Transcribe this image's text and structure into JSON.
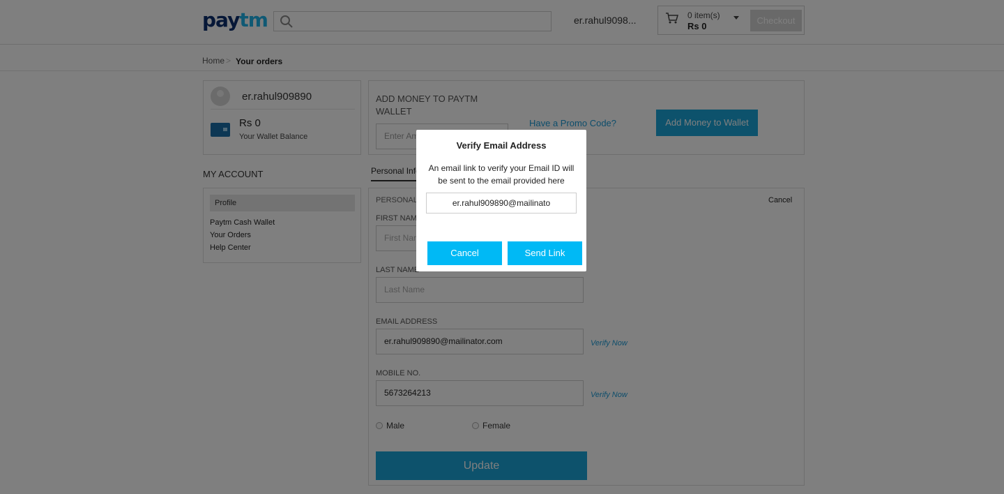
{
  "header": {
    "logo_pay": "pay",
    "logo_tm": "tm",
    "search_placeholder": "",
    "username": "er.rahul9098...",
    "cart_items": "0 item(s)",
    "cart_total": "Rs 0",
    "checkout_label": "Checkout"
  },
  "breadcrumb": {
    "home": "Home",
    "separator": ">",
    "current": "Your orders"
  },
  "profile": {
    "name": "er.rahul909890",
    "wallet_amount": "Rs 0",
    "wallet_label": "Your Wallet Balance"
  },
  "add_money": {
    "title": "ADD MONEY TO PAYTM WALLET",
    "amount_placeholder": "Enter Am",
    "promo_link": "Have a Promo Code?",
    "button_label": "Add Money to Wallet"
  },
  "account": {
    "title": "MY ACCOUNT",
    "nav": [
      "Profile",
      "Paytm Cash Wallet",
      "Your Orders",
      "Help Center"
    ]
  },
  "tabs": {
    "personal": "Personal Info"
  },
  "form": {
    "section_title": "PERSONAL",
    "cancel_label": "Cancel",
    "first_name_label": "FIRST NAME",
    "first_name_placeholder": "First Nam",
    "last_name_label": "LAST NAME",
    "last_name_placeholder": "Last Name",
    "email_label": "EMAIL ADDRESS",
    "email_value": "er.rahul909890@mailinator.com",
    "email_verify": "Verify Now",
    "mobile_label": "MOBILE NO.",
    "mobile_value": "5673264213",
    "mobile_verify": "Verify Now",
    "gender_male": "Male",
    "gender_female": "Female",
    "update_label": "Update"
  },
  "modal": {
    "title": "Verify Email Address",
    "text": "An email link to verify your Email ID will be sent to the email provided here",
    "email_value": "er.rahul909890@mailinato",
    "cancel_label": "Cancel",
    "send_label": "Send Link"
  },
  "colors": {
    "brand_dark": "#0d2f6e",
    "brand_light": "#1fb3e8",
    "button_primary": "#00b9f5",
    "link": "#1a9ad6"
  }
}
